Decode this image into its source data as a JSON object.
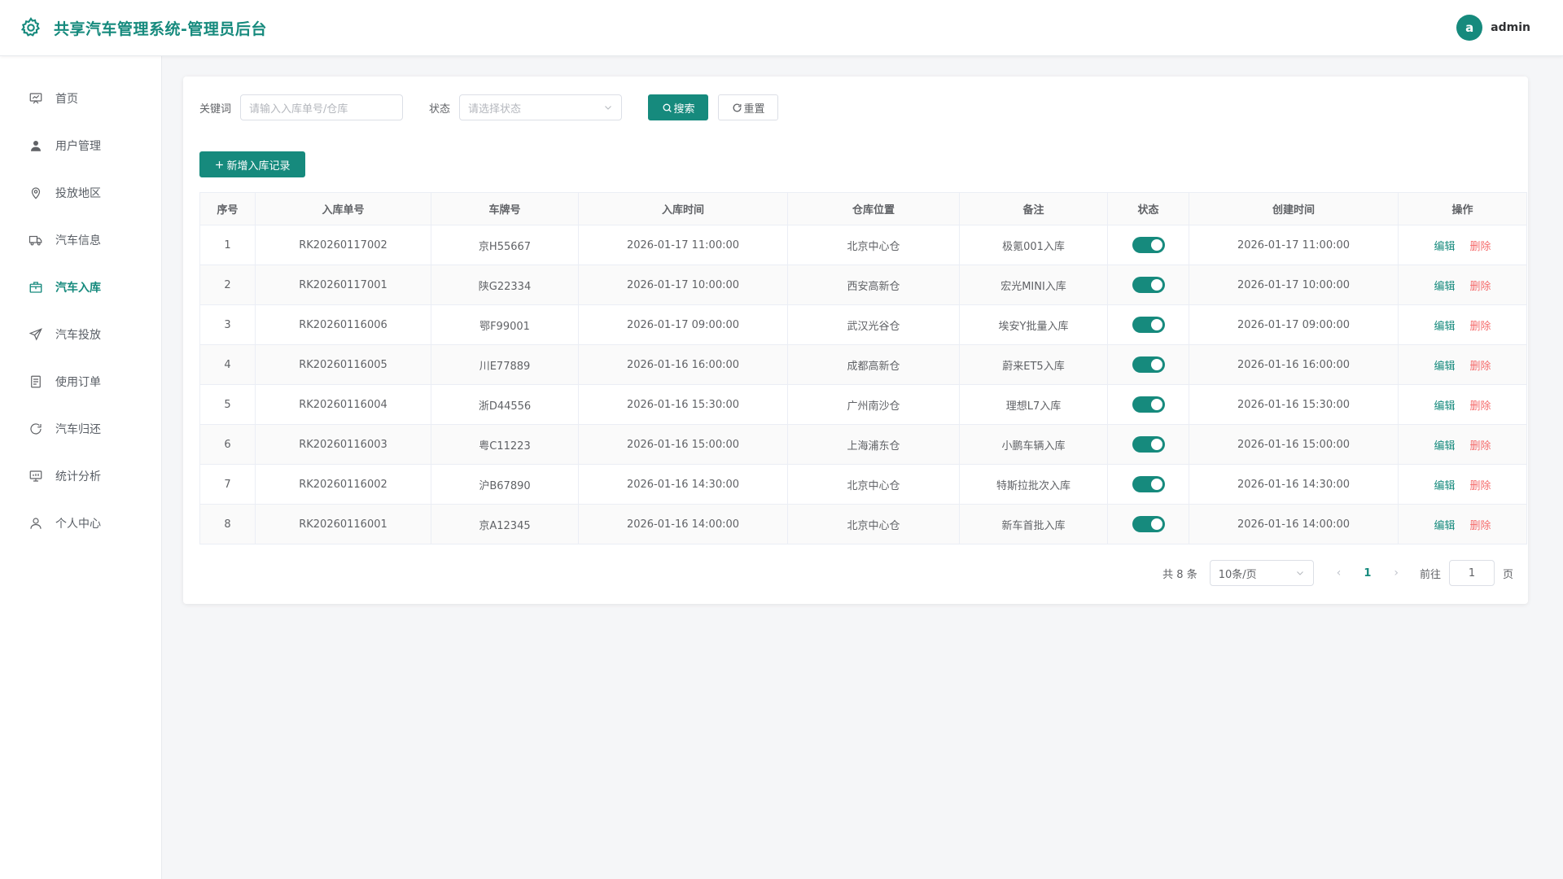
{
  "header": {
    "title": "共享汽车管理系统-管理员后台",
    "user": {
      "avatar_letter": "a",
      "name": "admin"
    }
  },
  "sidebar": {
    "items": [
      {
        "label": "首页",
        "icon": "dashboard-icon"
      },
      {
        "label": "用户管理",
        "icon": "user-icon"
      },
      {
        "label": "投放地区",
        "icon": "location-icon"
      },
      {
        "label": "汽车信息",
        "icon": "truck-icon"
      },
      {
        "label": "汽车入库",
        "icon": "box-icon",
        "active": true
      },
      {
        "label": "汽车投放",
        "icon": "send-icon"
      },
      {
        "label": "使用订单",
        "icon": "document-icon"
      },
      {
        "label": "汽车归还",
        "icon": "refresh-icon"
      },
      {
        "label": "统计分析",
        "icon": "chart-icon"
      },
      {
        "label": "个人中心",
        "icon": "person-icon"
      }
    ]
  },
  "search": {
    "keyword_label": "关键词",
    "keyword_placeholder": "请输入入库单号/仓库",
    "status_label": "状态",
    "status_placeholder": "请选择状态",
    "search_btn": "搜索",
    "reset_btn": "重置"
  },
  "toolbar": {
    "add_btn": "新增入库记录"
  },
  "table": {
    "columns": [
      "序号",
      "入库单号",
      "车牌号",
      "入库时间",
      "仓库位置",
      "备注",
      "状态",
      "创建时间",
      "操作"
    ],
    "edit_label": "编辑",
    "delete_label": "删除",
    "rows": [
      {
        "idx": "1",
        "no": "RK20260117002",
        "plate": "京H55667",
        "in_time": "2026-01-17 11:00:00",
        "warehouse": "北京中心仓",
        "remark": "极氪001入库",
        "status": true,
        "created": "2026-01-17 11:00:00"
      },
      {
        "idx": "2",
        "no": "RK20260117001",
        "plate": "陕G22334",
        "in_time": "2026-01-17 10:00:00",
        "warehouse": "西安高新仓",
        "remark": "宏光MINI入库",
        "status": true,
        "created": "2026-01-17 10:00:00"
      },
      {
        "idx": "3",
        "no": "RK20260116006",
        "plate": "鄂F99001",
        "in_time": "2026-01-17 09:00:00",
        "warehouse": "武汉光谷仓",
        "remark": "埃安Y批量入库",
        "status": true,
        "created": "2026-01-17 09:00:00"
      },
      {
        "idx": "4",
        "no": "RK20260116005",
        "plate": "川E77889",
        "in_time": "2026-01-16 16:00:00",
        "warehouse": "成都高新仓",
        "remark": "蔚来ET5入库",
        "status": true,
        "created": "2026-01-16 16:00:00"
      },
      {
        "idx": "5",
        "no": "RK20260116004",
        "plate": "浙D44556",
        "in_time": "2026-01-16 15:30:00",
        "warehouse": "广州南沙仓",
        "remark": "理想L7入库",
        "status": true,
        "created": "2026-01-16 15:30:00"
      },
      {
        "idx": "6",
        "no": "RK20260116003",
        "plate": "粤C11223",
        "in_time": "2026-01-16 15:00:00",
        "warehouse": "上海浦东仓",
        "remark": "小鹏车辆入库",
        "status": true,
        "created": "2026-01-16 15:00:00"
      },
      {
        "idx": "7",
        "no": "RK20260116002",
        "plate": "沪B67890",
        "in_time": "2026-01-16 14:30:00",
        "warehouse": "北京中心仓",
        "remark": "特斯拉批次入库",
        "status": true,
        "created": "2026-01-16 14:30:00"
      },
      {
        "idx": "8",
        "no": "RK20260116001",
        "plate": "京A12345",
        "in_time": "2026-01-16 14:00:00",
        "warehouse": "北京中心仓",
        "remark": "新车首批入库",
        "status": true,
        "created": "2026-01-16 14:00:00"
      }
    ]
  },
  "pagination": {
    "total_text": "共 8 条",
    "page_size": "10条/页",
    "current_page": "1",
    "goto_label": "前往",
    "goto_value": "1",
    "page_suffix": "页"
  },
  "colors": {
    "primary": "#168a7d",
    "danger": "#f56c6c"
  }
}
